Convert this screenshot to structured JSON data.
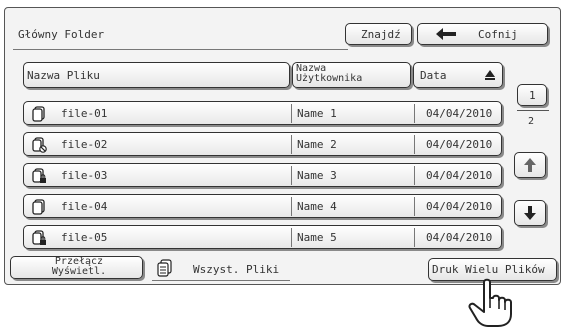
{
  "folder": {
    "title": "Główny Folder"
  },
  "toolbar": {
    "search_label": "Znajdź",
    "back_label": "Cofnij"
  },
  "columns": {
    "filename": "Nazwa Pliku",
    "username": "Nazwa Użytkownika",
    "date": "Data",
    "sort_icon": "triangle-up-icon"
  },
  "files": [
    {
      "name": "file-01",
      "user": "Name 1",
      "date": "04/04/2010",
      "icon": "file-icon"
    },
    {
      "name": "file-02",
      "user": "Name 2",
      "date": "04/04/2010",
      "icon": "file-blocked-icon"
    },
    {
      "name": "file-03",
      "user": "Name 3",
      "date": "04/04/2010",
      "icon": "file-locked-icon"
    },
    {
      "name": "file-04",
      "user": "Name 4",
      "date": "04/04/2010",
      "icon": "file-icon"
    },
    {
      "name": "file-05",
      "user": "Name 5",
      "date": "04/04/2010",
      "icon": "file-locked-icon"
    }
  ],
  "pagination": {
    "current_page": "1",
    "total_pages": "2"
  },
  "footer": {
    "switch_view_label": "Przełącz Wyświetl.",
    "all_files_label": "Wszyst. Pliki",
    "print_multiple_label": "Druk Wielu Plików"
  }
}
